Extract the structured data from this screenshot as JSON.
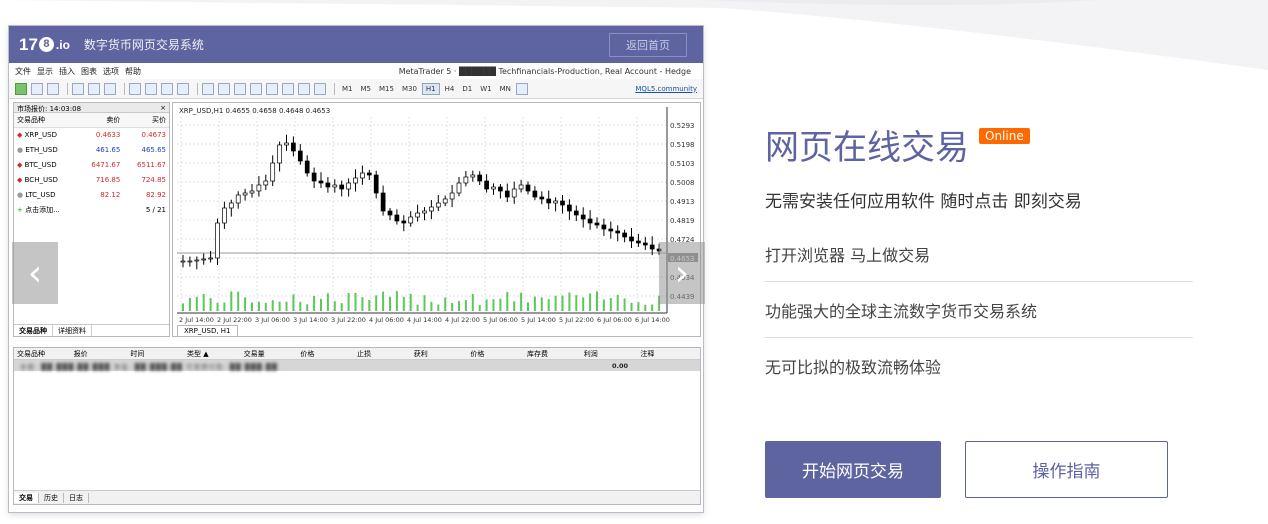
{
  "window": {
    "logo_num": "17",
    "logo_circle": "8",
    "logo_io": ".io",
    "app_title": "数字货币网页交易系统",
    "home_button": "返回首页",
    "menu": [
      "文件",
      "显示",
      "插入",
      "图表",
      "选项",
      "帮助"
    ],
    "server_info": "MetaTrader 5 · ██████ Techfinancials-Production, Real Account - Hedge",
    "timeframes": [
      "M1",
      "M5",
      "M15",
      "M30",
      "H1",
      "H4",
      "D1",
      "W1",
      "MN"
    ],
    "active_timeframe": "H1",
    "community_link": "MQL5.community"
  },
  "market_watch": {
    "title": "市场报价: 14:03:08",
    "close": "×",
    "columns": [
      "交易品种",
      "卖价",
      "买价"
    ],
    "rows": [
      {
        "symbol": "XRP_USD",
        "bid": "0.4633",
        "ask": "0.4673",
        "color": "red"
      },
      {
        "symbol": "ETH_USD",
        "bid": "461.65",
        "ask": "465.65",
        "color": "blue"
      },
      {
        "symbol": "BTC_USD",
        "bid": "6471.67",
        "ask": "6511.67",
        "color": "red"
      },
      {
        "symbol": "BCH_USD",
        "bid": "716.85",
        "ask": "724.85",
        "color": "red"
      },
      {
        "symbol": "LTC_USD",
        "bid": "82.12",
        "ask": "82.92",
        "color": "red"
      }
    ],
    "add_label": "点击添加...",
    "count": "5 / 21",
    "tabs": [
      "交易品种",
      "详细资料"
    ]
  },
  "chart": {
    "header": "XRP_USD,H1  0.4655 0.4658 0.4648 0.4653",
    "tab_label": "XRP_USD, H1",
    "price_labels": [
      "0.5293",
      "0.5198",
      "0.5103",
      "0.5008",
      "0.4913",
      "0.4819",
      "0.4724",
      "0.4653",
      "0.4534",
      "0.4439"
    ],
    "time_labels": [
      "2 Jul 14:00",
      "2 Jul 22:00",
      "3 Jul 06:00",
      "3 Jul 14:00",
      "3 Jul 22:00",
      "4 Jul 06:00",
      "4 Jul 14:00",
      "4 Jul 22:00",
      "5 Jul 06:00",
      "5 Jul 14:00",
      "5 Jul 22:00",
      "6 Jul 06:00",
      "6 Jul 14:00"
    ]
  },
  "terminal": {
    "columns": [
      "交易品种",
      "报价",
      "时间",
      "类型 ▲",
      "交易量",
      "价格",
      "止损",
      "获利",
      "价格",
      "库存费",
      "利润",
      "注释"
    ],
    "balance_row": "余额: ██ ███.██ ███  净值: ██ ███.██  可用预付款: ██ ███.██",
    "profit": "0.00",
    "tabs": [
      "交易",
      "历史",
      "日志"
    ]
  },
  "carousel": {
    "prev": "‹",
    "next": "›"
  },
  "promo": {
    "title": "网页在线交易",
    "badge": "Online",
    "subtitle": "无需安装任何应用软件 随时点击 即刻交易",
    "features": [
      "打开浏览器 马上做交易",
      "功能强大的全球主流数字货币交易系统",
      "无可比拟的极致流畅体验"
    ],
    "start_button": "开始网页交易",
    "guide_button": "操作指南"
  },
  "colors": {
    "brand": "#5d64a0",
    "badge": "#ff6a00",
    "bid_red": "#d02a2a",
    "ask_blue": "#2341c8"
  }
}
